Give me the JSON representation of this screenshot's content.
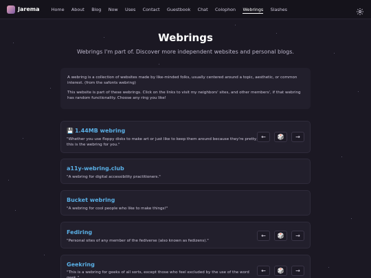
{
  "nav": {
    "brand": "Jarema",
    "links": [
      "Home",
      "About",
      "Blog",
      "Now",
      "Uses",
      "Contact",
      "Guestbook",
      "Chat",
      "Colophon",
      "Webrings",
      "Slashes"
    ],
    "active": "Webrings"
  },
  "page": {
    "title": "Webrings",
    "subtitle": "Webrings I'm part of. Discover more independent websites and personal blogs."
  },
  "intro": {
    "p1": "A webring is a collection of websites made by like-minded folks, usually centered around a topic, aesthetic, or common interest. (from the safonts webring)",
    "p2": "This website is part of these webrings. Click on the links to visit my neighbors' sites, and other members', if that webring has random functionality. Choose any ring you like!"
  },
  "webrings": [
    {
      "name": "1.44MB webring",
      "desc": "\"Whether you use floppy disks to make art or just like to keep them around because they're pretty, this is the webring for you.\"",
      "icon": "floppy-disk-icon"
    },
    {
      "name": "a11y-webring.club",
      "desc": "\"A webring for digital accessibility practitioners.\""
    },
    {
      "name": "Bucket webring",
      "desc": "\"A webring for cool people who like to make things!\""
    },
    {
      "name": "Fediring",
      "desc": "\"Personal sites of any member of the fediverse (also known as fedizens).\""
    },
    {
      "name": "Geekring",
      "desc": "\"This is a webring for geeks of all sorts, except those who feel excluded by the use of the word geek.\""
    }
  ],
  "buttons": {
    "prev": "←",
    "random": "🎲",
    "next": "→"
  }
}
